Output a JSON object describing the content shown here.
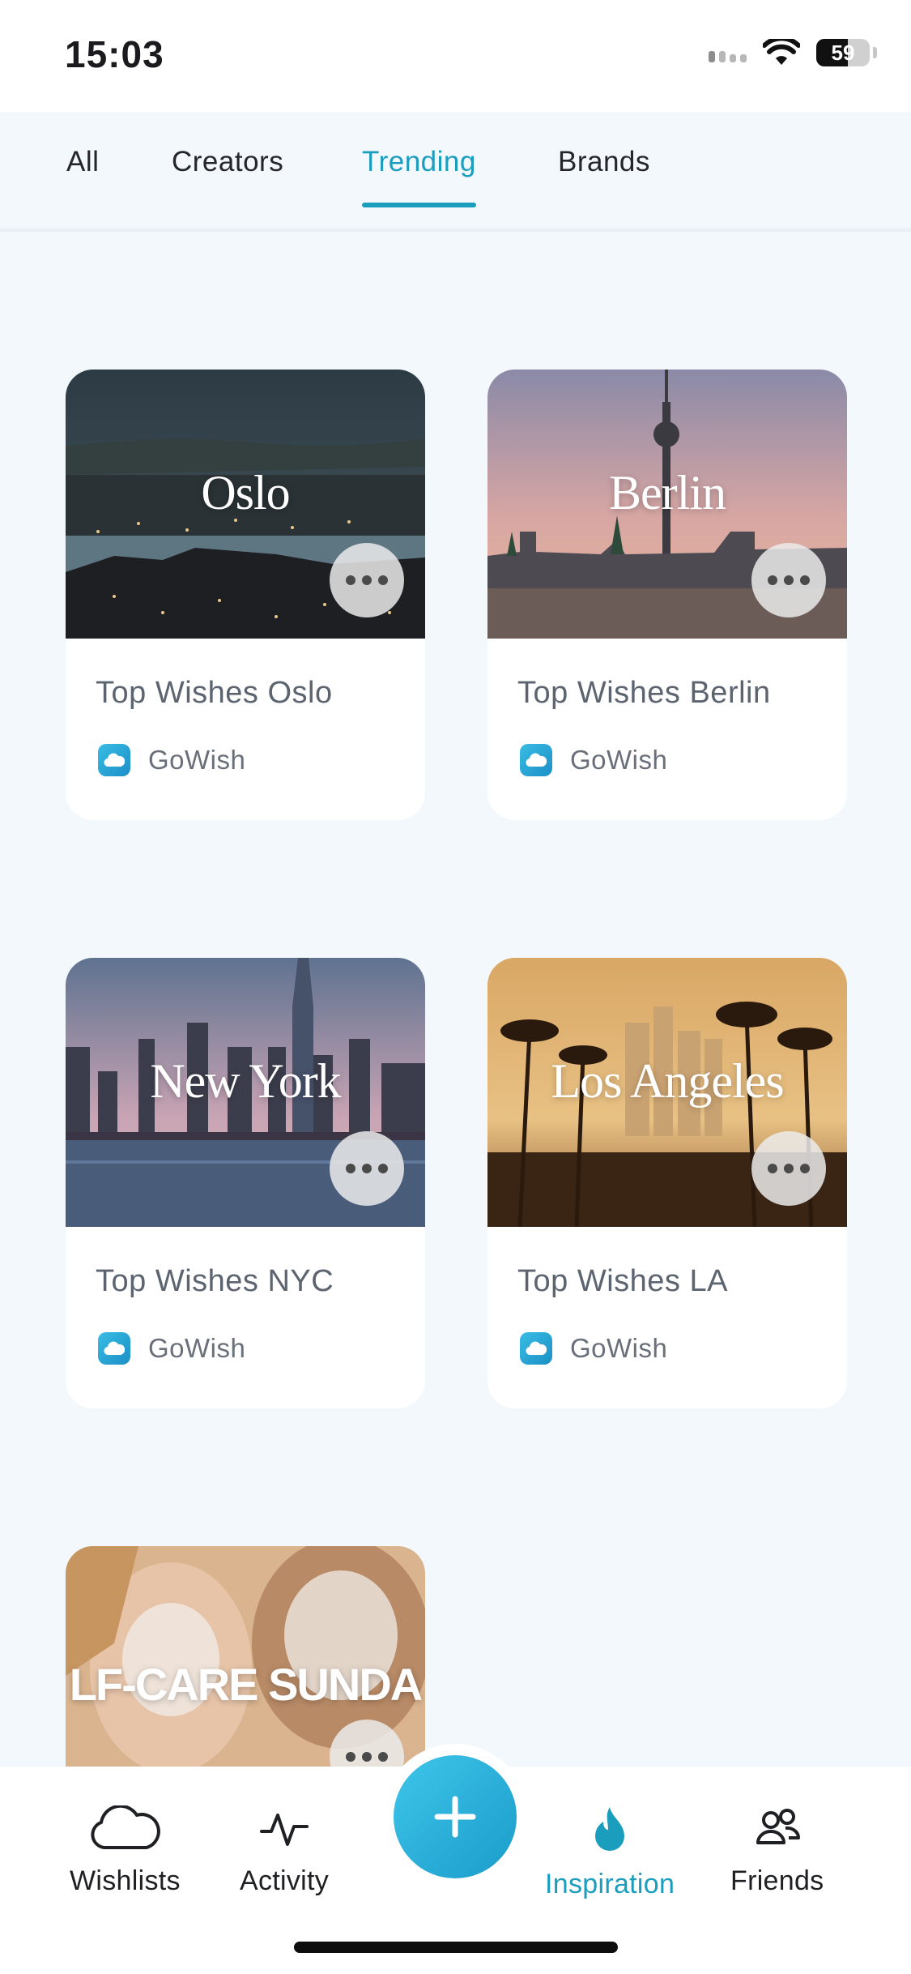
{
  "status_bar": {
    "time": "15:03",
    "battery": "59"
  },
  "tabs": [
    {
      "label": "All",
      "active": false
    },
    {
      "label": "Creators",
      "active": false
    },
    {
      "label": "Trending",
      "active": true
    },
    {
      "label": "Brands",
      "active": false
    }
  ],
  "cards": [
    {
      "image_text": "Oslo",
      "title": "Top Wishes Oslo",
      "creator": "GoWish"
    },
    {
      "image_text": "Berlin",
      "title": "Top Wishes Berlin",
      "creator": "GoWish"
    },
    {
      "image_text": "New York",
      "title": "Top Wishes NYC",
      "creator": "GoWish"
    },
    {
      "image_text": "Los Angeles",
      "title": "Top Wishes LA",
      "creator": "GoWish"
    },
    {
      "image_text": "LF-CARE SUNDA"
    }
  ],
  "bottom_nav": [
    {
      "label": "Wishlists",
      "icon": "cloud-icon"
    },
    {
      "label": "Activity",
      "icon": "activity-icon"
    },
    {
      "label": "Inspiration",
      "icon": "flame-icon",
      "active": true
    },
    {
      "label": "Friends",
      "icon": "friends-icon"
    }
  ],
  "colors": {
    "accent": "#1b9dbd",
    "background": "#f3f8fc"
  }
}
